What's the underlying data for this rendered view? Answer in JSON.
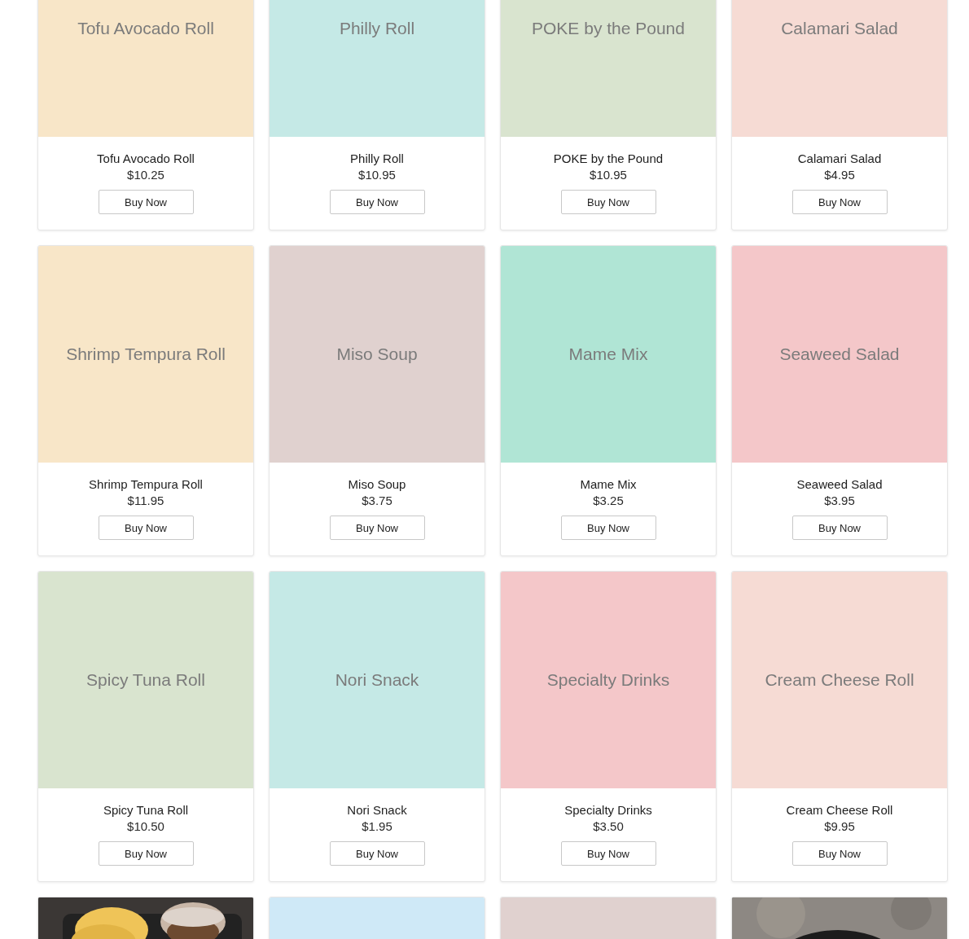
{
  "products": [
    {
      "kind": "placeholder",
      "color": "#f8e6c8",
      "image_label": "Tofu Avocado Roll",
      "name": "Tofu Avocado Roll",
      "price": "$10.25",
      "button": "Buy Now"
    },
    {
      "kind": "placeholder",
      "color": "#c5e9e6",
      "image_label": "Philly Roll",
      "name": "Philly Roll",
      "price": "$10.95",
      "button": "Buy Now"
    },
    {
      "kind": "placeholder",
      "color": "#d9e4cf",
      "image_label": "POKE by the Pound",
      "name": "POKE by the Pound",
      "price": "$10.95",
      "button": "Buy Now"
    },
    {
      "kind": "placeholder",
      "color": "#f6dbd4",
      "image_label": "Calamari Salad",
      "name": "Calamari Salad",
      "price": "$4.95",
      "button": "Buy Now"
    },
    {
      "kind": "placeholder",
      "color": "#f8e6c8",
      "image_label": "Shrimp Tempura Roll",
      "name": "Shrimp Tempura Roll",
      "price": "$11.95",
      "button": "Buy Now"
    },
    {
      "kind": "placeholder",
      "color": "#e0d1cf",
      "image_label": "Miso Soup",
      "name": "Miso Soup",
      "price": "$3.75",
      "button": "Buy Now"
    },
    {
      "kind": "placeholder",
      "color": "#b0e5d5",
      "image_label": "Mame Mix",
      "name": "Mame Mix",
      "price": "$3.25",
      "button": "Buy Now"
    },
    {
      "kind": "placeholder",
      "color": "#f4c7c9",
      "image_label": "Seaweed Salad",
      "name": "Seaweed Salad",
      "price": "$3.95",
      "button": "Buy Now"
    },
    {
      "kind": "placeholder",
      "color": "#d9e4cf",
      "image_label": "Spicy Tuna Roll",
      "name": "Spicy Tuna Roll",
      "price": "$10.50",
      "button": "Buy Now"
    },
    {
      "kind": "placeholder",
      "color": "#c5e9e6",
      "image_label": "Nori Snack",
      "name": "Nori Snack",
      "price": "$1.95",
      "button": "Buy Now"
    },
    {
      "kind": "placeholder",
      "color": "#f4c7c9",
      "image_label": "Specialty Drinks",
      "name": "Specialty Drinks",
      "price": "$3.50",
      "button": "Buy Now"
    },
    {
      "kind": "placeholder",
      "color": "#f6dbd4",
      "image_label": "Cream Cheese Roll",
      "name": "Cream Cheese Roll",
      "price": "$9.95",
      "button": "Buy Now"
    },
    {
      "kind": "picture"
    },
    {
      "kind": "placeholder",
      "color": "#cfe9f7"
    },
    {
      "kind": "placeholder",
      "color": "#e0d1cf"
    },
    {
      "kind": "picture"
    }
  ]
}
